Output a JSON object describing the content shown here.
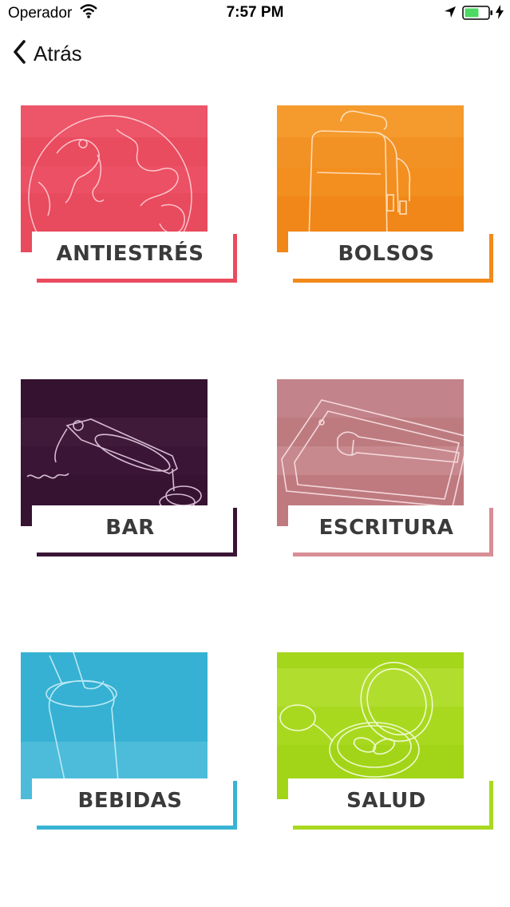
{
  "status_bar": {
    "carrier": "Operador",
    "time": "7:57 PM",
    "icons": [
      "wifi-icon",
      "location-arrow-icon",
      "battery-icon",
      "charging-bolt-icon"
    ]
  },
  "nav": {
    "back_label": "Atrás",
    "back_icon": "chevron-left-icon"
  },
  "categories": [
    {
      "label": "ANTIESTRÉS",
      "color": "#e94b5f",
      "icon": "globe-icon"
    },
    {
      "label": "BOLSOS",
      "color": "#f28a1b",
      "icon": "backpack-icon"
    },
    {
      "label": "BAR",
      "color": "#3a1535",
      "icon": "bottle-opener-icon"
    },
    {
      "label": "ESCRITURA",
      "color": "#bf7a7f",
      "icon": "tablet-pen-icon"
    },
    {
      "label": "BEBIDAS",
      "color": "#38b3d4",
      "icon": "tumbler-icon"
    },
    {
      "label": "SALUD",
      "color": "#a8d91f",
      "icon": "pill-box-icon"
    }
  ]
}
